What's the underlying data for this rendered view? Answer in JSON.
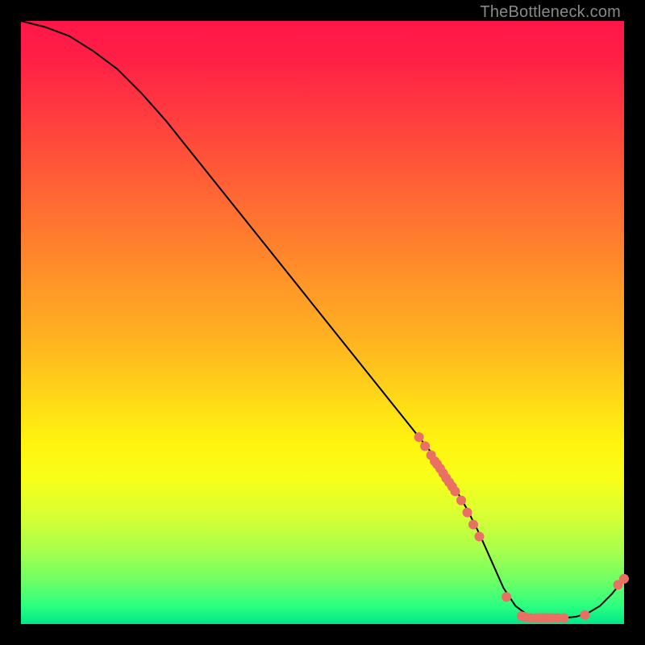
{
  "attribution": "TheBottleneck.com",
  "colors": {
    "dot": "#e97063",
    "curve": "#000000",
    "gradient_top": "#ff1648",
    "gradient_bottom": "#00e78a",
    "page_bg": "#000000"
  },
  "chart_data": {
    "type": "line",
    "title": "",
    "xlabel": "",
    "ylabel": "",
    "xlim": [
      0,
      100
    ],
    "ylim": [
      0,
      100
    ],
    "grid": false,
    "legend": false,
    "series": [
      {
        "name": "bottleneck-curve",
        "x": [
          0,
          4,
          8,
          12,
          16,
          20,
          24,
          28,
          32,
          36,
          40,
          44,
          48,
          52,
          56,
          60,
          64,
          68,
          70,
          72,
          74,
          76,
          78,
          80,
          82,
          84,
          86,
          88,
          90,
          92,
          94,
          96,
          98,
          100
        ],
        "y": [
          100,
          99,
          97.5,
          95,
          92,
          88,
          83.5,
          78.5,
          73.5,
          68.5,
          63.5,
          58.5,
          53.5,
          48.5,
          43.5,
          38.5,
          33.5,
          28.5,
          25.5,
          22.5,
          19,
          15,
          10.5,
          6,
          3,
          1.5,
          1,
          1,
          1,
          1.2,
          1.8,
          3,
          5,
          7.5
        ]
      }
    ],
    "scatter_points": {
      "name": "highlight-dots",
      "points": [
        {
          "x": 66,
          "y": 31
        },
        {
          "x": 67,
          "y": 29.5
        },
        {
          "x": 68,
          "y": 28
        },
        {
          "x": 68.6,
          "y": 27
        },
        {
          "x": 69,
          "y": 26.5
        },
        {
          "x": 69.5,
          "y": 25.8
        },
        {
          "x": 70,
          "y": 25
        },
        {
          "x": 70.5,
          "y": 24.2
        },
        {
          "x": 71,
          "y": 23.5
        },
        {
          "x": 71.5,
          "y": 22.8
        },
        {
          "x": 72,
          "y": 22
        },
        {
          "x": 73,
          "y": 20.5
        },
        {
          "x": 74,
          "y": 18.5
        },
        {
          "x": 75,
          "y": 16.5
        },
        {
          "x": 76,
          "y": 14.5
        },
        {
          "x": 80.5,
          "y": 4.5
        },
        {
          "x": 83,
          "y": 1.3
        },
        {
          "x": 83.5,
          "y": 1.2
        },
        {
          "x": 84.5,
          "y": 1
        },
        {
          "x": 85.5,
          "y": 1
        },
        {
          "x": 86,
          "y": 1
        },
        {
          "x": 86.6,
          "y": 1
        },
        {
          "x": 87,
          "y": 1
        },
        {
          "x": 87.5,
          "y": 1
        },
        {
          "x": 88.2,
          "y": 1
        },
        {
          "x": 89,
          "y": 1
        },
        {
          "x": 90,
          "y": 1
        },
        {
          "x": 93.5,
          "y": 1.5
        },
        {
          "x": 99,
          "y": 6.5
        },
        {
          "x": 100,
          "y": 7.5
        }
      ]
    }
  }
}
